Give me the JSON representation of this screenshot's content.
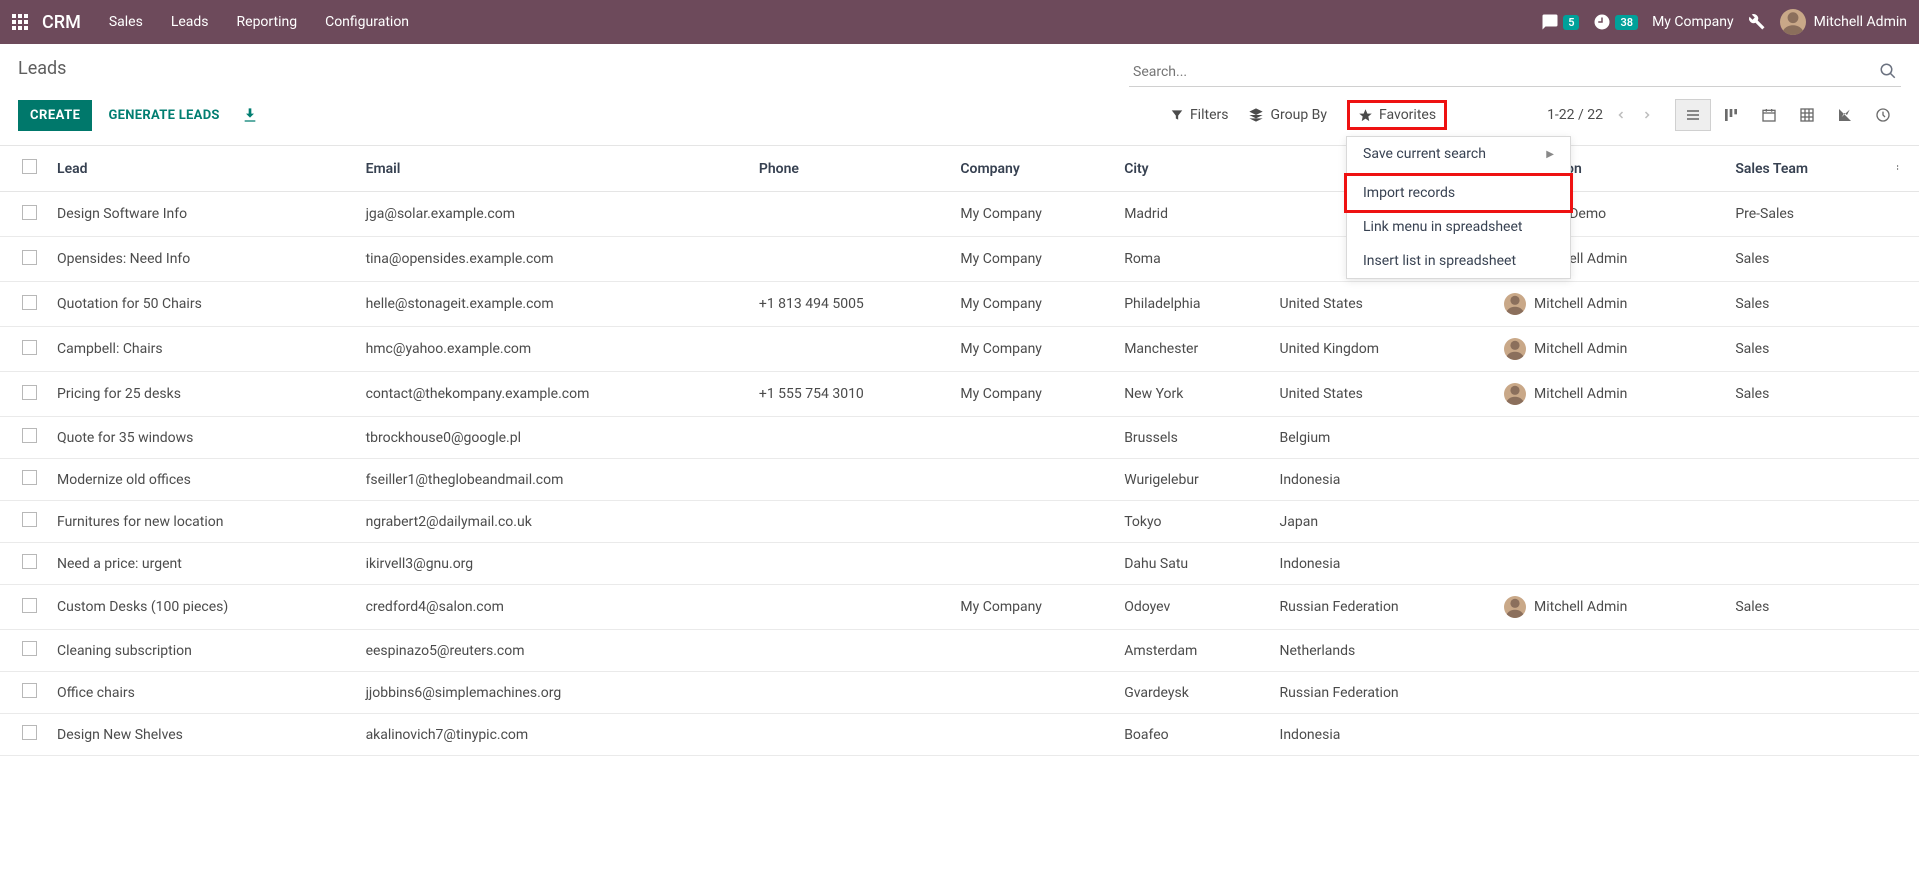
{
  "header": {
    "brand": "CRM",
    "nav": [
      "Sales",
      "Leads",
      "Reporting",
      "Configuration"
    ],
    "chat_badge": "5",
    "activity_badge": "38",
    "company": "My Company",
    "user": "Mitchell Admin"
  },
  "page": {
    "title": "Leads",
    "search_placeholder": "Search...",
    "create_label": "CREATE",
    "generate_label": "GENERATE LEADS",
    "filters_label": "Filters",
    "groupby_label": "Group By",
    "favorites_label": "Favorites",
    "pager": "1-22 / 22"
  },
  "favorites_menu": {
    "save": "Save current search",
    "import": "Import records",
    "link": "Link menu in spreadsheet",
    "insert": "Insert list in spreadsheet"
  },
  "columns": {
    "lead": "Lead",
    "email": "Email",
    "phone": "Phone",
    "company": "Company",
    "city": "City",
    "country": "",
    "salesperson": "Salesperson",
    "salesteam": "Sales Team"
  },
  "rows": [
    {
      "lead": "Design Software Info",
      "email": "jga@solar.example.com",
      "phone": "",
      "company": "My Company",
      "city": "Madrid",
      "country": "",
      "salesperson": "Marc Demo",
      "salesteam": "Pre-Sales",
      "has_sp": true
    },
    {
      "lead": "Opensides: Need Info",
      "email": "tina@opensides.example.com",
      "phone": "",
      "company": "My Company",
      "city": "Roma",
      "country": "",
      "salesperson": "Mitchell Admin",
      "salesteam": "Sales",
      "has_sp": true
    },
    {
      "lead": "Quotation for 50 Chairs",
      "email": "helle@stonageit.example.com",
      "phone": "+1 813 494 5005",
      "company": "My Company",
      "city": "Philadelphia",
      "country": "United States",
      "salesperson": "Mitchell Admin",
      "salesteam": "Sales",
      "has_sp": true
    },
    {
      "lead": "Campbell: Chairs",
      "email": "hmc@yahoo.example.com",
      "phone": "",
      "company": "My Company",
      "city": "Manchester",
      "country": "United Kingdom",
      "salesperson": "Mitchell Admin",
      "salesteam": "Sales",
      "has_sp": true
    },
    {
      "lead": "Pricing for 25 desks",
      "email": "contact@thekompany.example.com",
      "phone": "+1 555 754 3010",
      "company": "My Company",
      "city": "New York",
      "country": "United States",
      "salesperson": "Mitchell Admin",
      "salesteam": "Sales",
      "has_sp": true
    },
    {
      "lead": "Quote for 35 windows",
      "email": "tbrockhouse0@google.pl",
      "phone": "",
      "company": "",
      "city": "Brussels",
      "country": "Belgium",
      "salesperson": "",
      "salesteam": "",
      "has_sp": false
    },
    {
      "lead": "Modernize old offices",
      "email": "fseiller1@theglobeandmail.com",
      "phone": "",
      "company": "",
      "city": "Wurigelebur",
      "country": "Indonesia",
      "salesperson": "",
      "salesteam": "",
      "has_sp": false
    },
    {
      "lead": "Furnitures for new location",
      "email": "ngrabert2@dailymail.co.uk",
      "phone": "",
      "company": "",
      "city": "Tokyo",
      "country": "Japan",
      "salesperson": "",
      "salesteam": "",
      "has_sp": false
    },
    {
      "lead": "Need a price: urgent",
      "email": "ikirvell3@gnu.org",
      "phone": "",
      "company": "",
      "city": "Dahu Satu",
      "country": "Indonesia",
      "salesperson": "",
      "salesteam": "",
      "has_sp": false
    },
    {
      "lead": "Custom Desks (100 pieces)",
      "email": "credford4@salon.com",
      "phone": "",
      "company": "My Company",
      "city": "Odoyev",
      "country": "Russian Federation",
      "salesperson": "Mitchell Admin",
      "salesteam": "Sales",
      "has_sp": true
    },
    {
      "lead": "Cleaning subscription",
      "email": "eespinazo5@reuters.com",
      "phone": "",
      "company": "",
      "city": "Amsterdam",
      "country": "Netherlands",
      "salesperson": "",
      "salesteam": "",
      "has_sp": false
    },
    {
      "lead": "Office chairs",
      "email": "jjobbins6@simplemachines.org",
      "phone": "",
      "company": "",
      "city": "Gvardeysk",
      "country": "Russian Federation",
      "salesperson": "",
      "salesteam": "",
      "has_sp": false
    },
    {
      "lead": "Design New Shelves",
      "email": "akalinovich7@tinypic.com",
      "phone": "",
      "company": "",
      "city": "Boafeo",
      "country": "Indonesia",
      "salesperson": "",
      "salesteam": "",
      "has_sp": false
    }
  ]
}
